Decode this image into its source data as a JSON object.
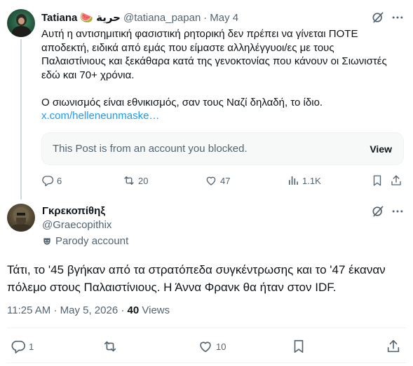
{
  "parent": {
    "name": "Tatiana",
    "emoji": "🍉",
    "arabic_name": "حرية",
    "handle": "@tatiana_papan",
    "separator": "·",
    "date": "May 4",
    "text_lines": [
      "Αυτή η αντισημιτική φασιστική ρητορική δεν πρέπει να γίνεται ΠΟΤΕ",
      "αποδεκτή, ειδικά από εμάς που είμαστε αλληλέγγυοι/ες με τους",
      "Παλαιστίνιους και ξεκάθαρα κατά της γενοκτονίας που κάνουν οι Σιωνιστές",
      "εδώ και 70+ χρόνια."
    ],
    "text_line2": "Ο σιωνισμός είναι εθνικισμός, σαν τους Ναζί δηλαδή, το ίδιο.",
    "link": "x.com/helleneunmaske…",
    "blocked_message": "This Post is from an account you blocked.",
    "view_label": "View",
    "replies": "6",
    "reposts": "20",
    "likes": "47",
    "views": "1.1K"
  },
  "reply": {
    "name": "Γκρεκοπίθηξ",
    "handle": "@Graecopithix",
    "parody_label": "Parody account",
    "text": "Τάτι, το '45 βγήκαν από τα στρατόπεδα συγκέντρωσης και το '47 έκαναν πόλεμο στους Παλαιστίνιους. Η Άννα Φρανκ θα ήταν στον IDF.",
    "time": "11:25 AM",
    "separator": "·",
    "date": "May 5, 2026",
    "views_count": "40",
    "views_label": "Views",
    "replies": "1",
    "likes": "10"
  },
  "colors": {
    "text": "#0f1419",
    "secondary": "#536471",
    "link": "#1d9bf0",
    "border": "#eff3f4",
    "card_bg": "#f7f9f9"
  },
  "icons": [
    "grok-icon",
    "more-icon",
    "reply-icon",
    "repost-icon",
    "like-icon",
    "views-icon",
    "bookmark-icon",
    "share-icon",
    "parody-mask-icon"
  ]
}
